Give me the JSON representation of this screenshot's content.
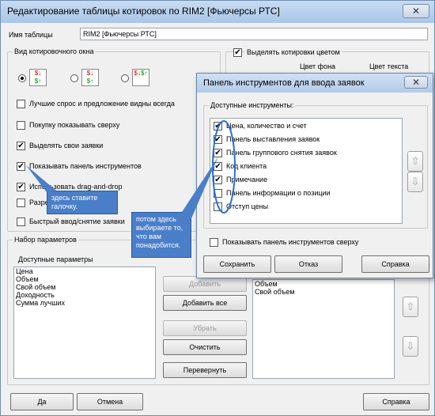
{
  "window": {
    "title": "Редактирование таблицы котировок по RIM2 [Фьючерсы РТС]",
    "close": "✕"
  },
  "table_name": {
    "label": "Имя таблицы",
    "value": "RIM2 [Фьючерсы РТС]"
  },
  "view_group": {
    "label": "Вид котировочного окна"
  },
  "options": [
    {
      "label": "Лучшие спрос и предложение видны всегда",
      "checked": false
    },
    {
      "label": "Покупку показывать сверху",
      "checked": false
    },
    {
      "label": "Выделять свои заявки",
      "checked": true
    },
    {
      "label": "Показывать панель инструментов",
      "checked": true
    },
    {
      "label": "Использовать drag-and-drop",
      "checked": true
    },
    {
      "label": "Разре",
      "checked": false
    },
    {
      "label": "Быстрый ввод/снятие заявки",
      "checked": false
    }
  ],
  "color_group": {
    "label": "Выделять котировки цветом",
    "bg": "Цвет фона",
    "text": "Цвет текста"
  },
  "params": {
    "group": "Набор параметров",
    "available": "Доступные параметры",
    "items": [
      "Цена",
      "Объем",
      "Свой объем",
      "Доходность",
      "Сумма лучших"
    ],
    "selected": [
      "Объем",
      "Свой объем"
    ],
    "buttons": {
      "add": "Добавить",
      "add_all": "Добавить все",
      "remove": "Убрать",
      "clear": "Очистить",
      "flip": "Перевернуть"
    }
  },
  "footer": {
    "ok": "Да",
    "cancel": "Отмена",
    "help": "Справка"
  },
  "dialog": {
    "title": "Панель инструментов для ввода заявок",
    "close": "✕",
    "group": "Доступные инструменты:",
    "tools": [
      {
        "label": "Цена, количество и счет",
        "checked": true
      },
      {
        "label": "Панель выставления заявок",
        "checked": true
      },
      {
        "label": "Панель группового снятия заявок",
        "checked": true
      },
      {
        "label": "Код клиента",
        "checked": true
      },
      {
        "label": "Примечание",
        "checked": true
      },
      {
        "label": "Панель информации о позиции",
        "checked": false
      },
      {
        "label": "Отступ цены",
        "checked": false
      }
    ],
    "show_top": "Показывать панель инструментов сверху",
    "save": "Сохранить",
    "cancel": "Отказ",
    "help": "Справка"
  },
  "callout1": "здесь ставите галочку.",
  "callout2": "потом здесь выбираете то, что вам понадобится.",
  "colors": {
    "callout": "#4a7ec8",
    "highlight_ring": "#2a6fd6"
  }
}
